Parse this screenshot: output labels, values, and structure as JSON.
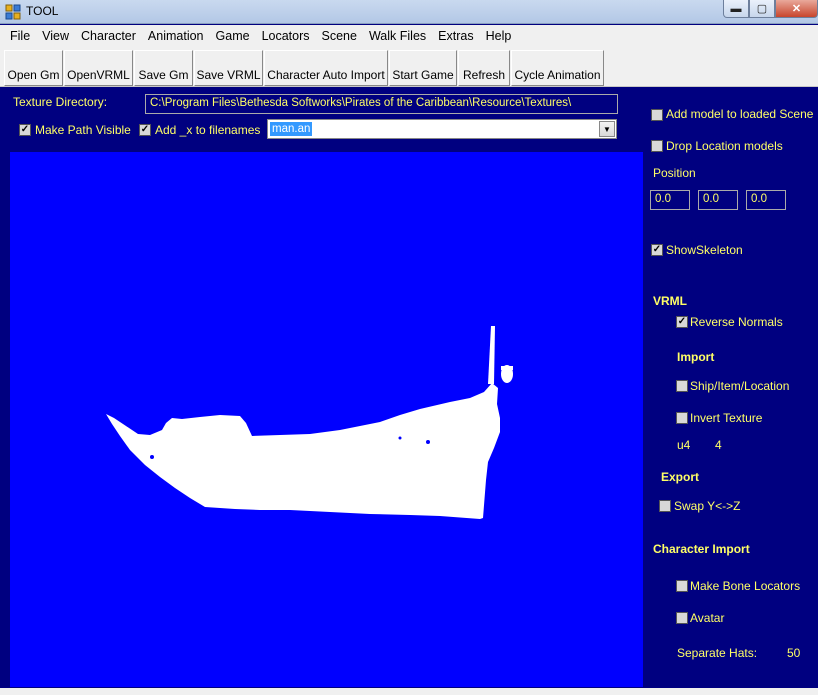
{
  "window": {
    "title": "TOOL",
    "minimize_label": "▬",
    "maximize_label": "▢",
    "close_label": "✕"
  },
  "menu": [
    "File",
    "View",
    "Character",
    "Animation",
    "Game",
    "Locators",
    "Scene",
    "Walk Files",
    "Extras",
    "Help"
  ],
  "toolbar": [
    "Open Gm",
    "OpenVRML",
    "Save Gm",
    "Save VRML",
    "Character Auto Import",
    "Start Game",
    "Refresh",
    "Cycle Animation"
  ],
  "texture": {
    "label": "Texture Directory:",
    "path": "C:\\Program Files\\Bethesda Softworks\\Pirates of the Caribbean\\Resource\\Textures\\"
  },
  "options": {
    "make_path_visible": {
      "label": "Make Path Visible",
      "checked": true
    },
    "add_x": {
      "label": "Add _x to filenames",
      "checked": true
    },
    "animation_file": "man.an"
  },
  "right_panel": {
    "add_model": {
      "label": "Add model to loaded Scene",
      "checked": false
    },
    "drop_location": {
      "label": "Drop Location models",
      "checked": false
    },
    "position_label": "Position",
    "position": [
      "0.0",
      "0.0",
      "0.0"
    ],
    "show_skeleton": {
      "label": "ShowSkeleton",
      "checked": true
    },
    "vrml_header": "VRML",
    "reverse_normals": {
      "label": "Reverse Normals",
      "checked": true
    },
    "import_header": "Import",
    "ship_item_location": {
      "label": "Ship/Item/Location",
      "checked": false
    },
    "invert_texture": {
      "label": "Invert Texture",
      "checked": false
    },
    "u_label": "u4",
    "u_value": "4",
    "export_header": "Export",
    "swap_yz": {
      "label": "Swap  Y<->Z",
      "checked": false
    },
    "character_import_header": "Character Import",
    "make_bone_locators": {
      "label": "Make Bone Locators",
      "checked": false
    },
    "avatar": {
      "label": "Avatar",
      "checked": false
    },
    "separate_hats_label": "Separate Hats:",
    "separate_hats_value": "50"
  },
  "colors": {
    "panel_bg": "#000080",
    "viewport_bg": "#0000ff",
    "label_text": "#ffff66",
    "model": "#ffffff"
  }
}
